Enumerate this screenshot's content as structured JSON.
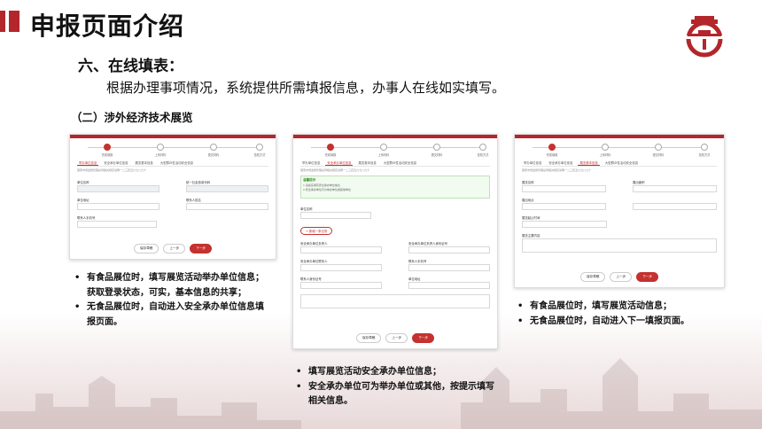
{
  "title": "申报页面介绍",
  "section_heading": "六、在线填表：",
  "section_desc": "根据办理事项情况，系统提供所需填报信息，办事人在线如实填写。",
  "sub_heading": "（二）涉外经济技术展览",
  "brand_color": "#b3262b",
  "shot1": {
    "steps": [
      "完成填报",
      "上传材料",
      "提交材料",
      "告知方式"
    ],
    "tabs": [
      "举办单位信息",
      "安全承办单位信息",
      "展览基本信息",
      "大型群众性活动安全信息"
    ],
    "hint": "国家市场监督管理总局相关规定说明一二三四五六七八九十",
    "fields": [
      "单位名称",
      "统一社会信用代码",
      "单位地址",
      "联系人姓名",
      "联系人手机号"
    ],
    "buttons": [
      "保存草稿",
      "上一步",
      "下一步"
    ]
  },
  "shot2": {
    "steps": [
      "完成填报",
      "上传材料",
      "提交材料",
      "告知方式"
    ],
    "tabs": [
      "举办单位信息",
      "安全承办单位信息",
      "展览基本信息",
      "大型群众性活动安全信息"
    ],
    "hint": "国家市场监督管理总局相关规定说明一二三四五六七八九十",
    "warn_title": "温馨提示",
    "warn_lines": [
      "1.请如实填写安全承办单位信息",
      "2.安全承办单位可为举办单位或其他单位"
    ],
    "add_label": "+ 新增一条记录",
    "fields": [
      "单位名称",
      "安全承办单位负责人",
      "安全承办单位负责人身份证号",
      "安全承办单位联系人",
      "联系人手机号",
      "联系人身份证号",
      "单位地址"
    ],
    "buttons": [
      "保存草稿",
      "上一步",
      "下一步"
    ]
  },
  "shot3": {
    "steps": [
      "完成填报",
      "上传材料",
      "提交材料",
      "告知方式"
    ],
    "tabs": [
      "举办单位信息",
      "安全承办单位信息",
      "展览基本信息",
      "大型群众性活动安全信息"
    ],
    "hint": "国家市场监督管理总局相关规定说明一二三四五六七八九十",
    "fields": [
      "展览名称",
      "展出面积",
      "展出地点",
      "展览起止时间",
      "展览主要内容"
    ],
    "buttons": [
      "保存草稿",
      "上一步",
      "下一步"
    ]
  },
  "bullets1": [
    {
      "text": "有食品展位时，填写展览活动举办单位信息；",
      "cont": "获取登录状态，可实，基本信息的共享；"
    },
    {
      "text": "无食品展位时，自动进入安全承办单位信息填",
      "cont": "报页面。"
    }
  ],
  "bullets2": [
    {
      "text": "填写展览活动安全承办单位信息；",
      "cont": ""
    },
    {
      "text": "安全承办单位可为举办单位或其他，按提示填写",
      "cont": "相关信息。"
    }
  ],
  "bullets3": [
    {
      "text": "有食品展位时，填写展览活动信息；",
      "cont": ""
    },
    {
      "text": "无食品展位时，自动进入下一填报页面。",
      "cont": ""
    }
  ]
}
